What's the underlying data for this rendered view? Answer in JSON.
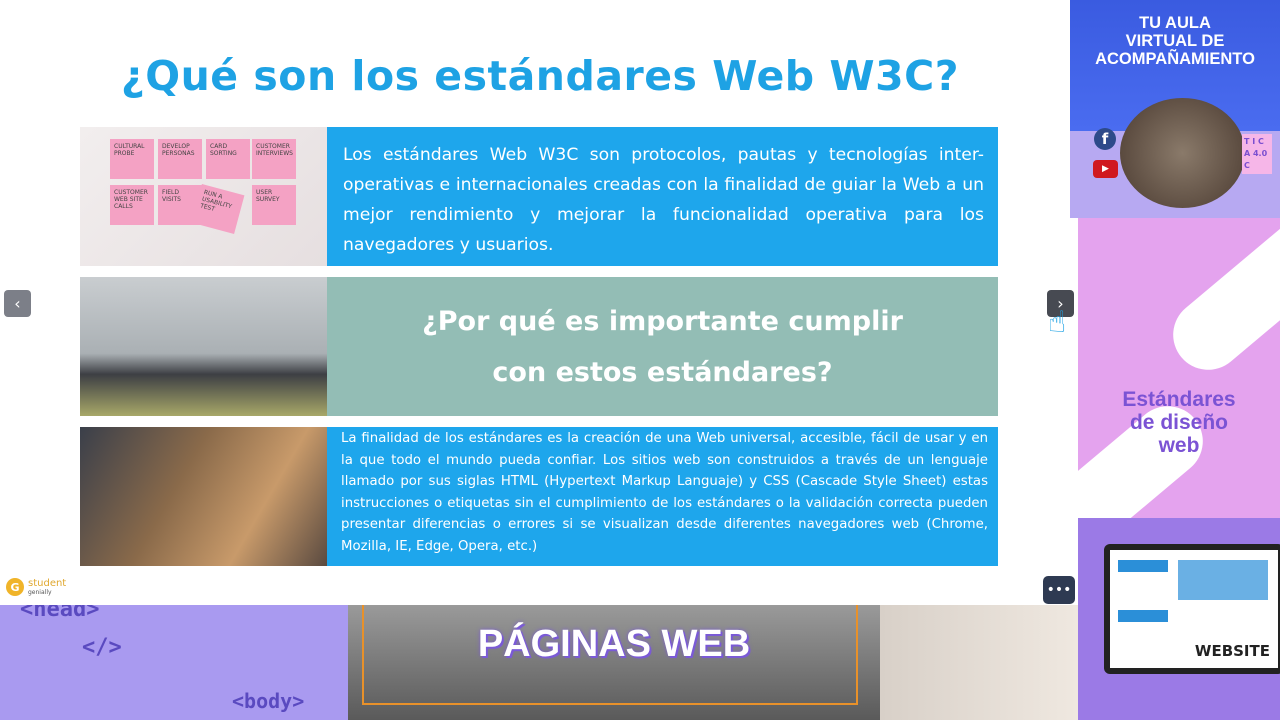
{
  "slide": {
    "title": "¿Qué son los estándares Web W3C?",
    "block1_text": "Los estándares Web W3C son protocolos, pautas y tecnologías inter-operativas e internacionales creadas con la finalidad de guiar la Web a un mejor rendimiento y mejorar la funcionalidad operativa para los navegadores y usuarios.",
    "block2_heading_line1": "¿Por qué es importante cumplir",
    "block2_heading_line2": "con estos estándares?",
    "block3_text": "La finalidad de los estándares es la creación de una Web universal, accesible, fácil de usar y en la que todo el mundo pueda confiar.  Los sitios web son construidos a través de un lenguaje llamado por sus siglas HTML (Hypertext Markup Languaje) y CSS (Cascade Style Sheet) estas instrucciones o etiquetas sin el cumplimiento de los estándares o la validación correcta pueden presentar diferencias o errores si se visualizan desde diferentes navegadores web (Chrome, Mozilla, IE, Edge, Opera, etc.)",
    "sticky_notes": [
      "CULTURAL PROBE",
      "DEVELOP PERSONAS",
      "CARD SORTING",
      "CUSTOMER INTERVIEWS",
      "CUSTOMER WEB SITE CALLS",
      "FIELD VISITS",
      "RUN A USABILITY TEST",
      "USER SURVEY"
    ],
    "colors": {
      "title": "#1ea2e4",
      "box_blue": "#1ea6ec",
      "box_teal": "#93bdb5"
    }
  },
  "nav": {
    "prev_icon": "chevron-left",
    "prev": "‹",
    "next_icon": "chevron-right",
    "next": "›",
    "more": "•••"
  },
  "logo": {
    "mark": "G",
    "line1": "student",
    "line2": "genially"
  },
  "side": {
    "top_title_l1": "TU AULA",
    "top_title_l2": "VIRTUAL DE",
    "top_title_l3": "ACOMPAÑAMIENTO",
    "facebook": "f",
    "youtube": "▶",
    "tic_badge": "T I C A 4.0 C",
    "mid_l1": "Estándares",
    "mid_l2": "de diseño",
    "mid_l3": "web",
    "website": "WEBSITE"
  },
  "bottom": {
    "code1": "<head>",
    "code2": "</>",
    "code3": "<body>",
    "title": "PÁGINAS WEB"
  }
}
